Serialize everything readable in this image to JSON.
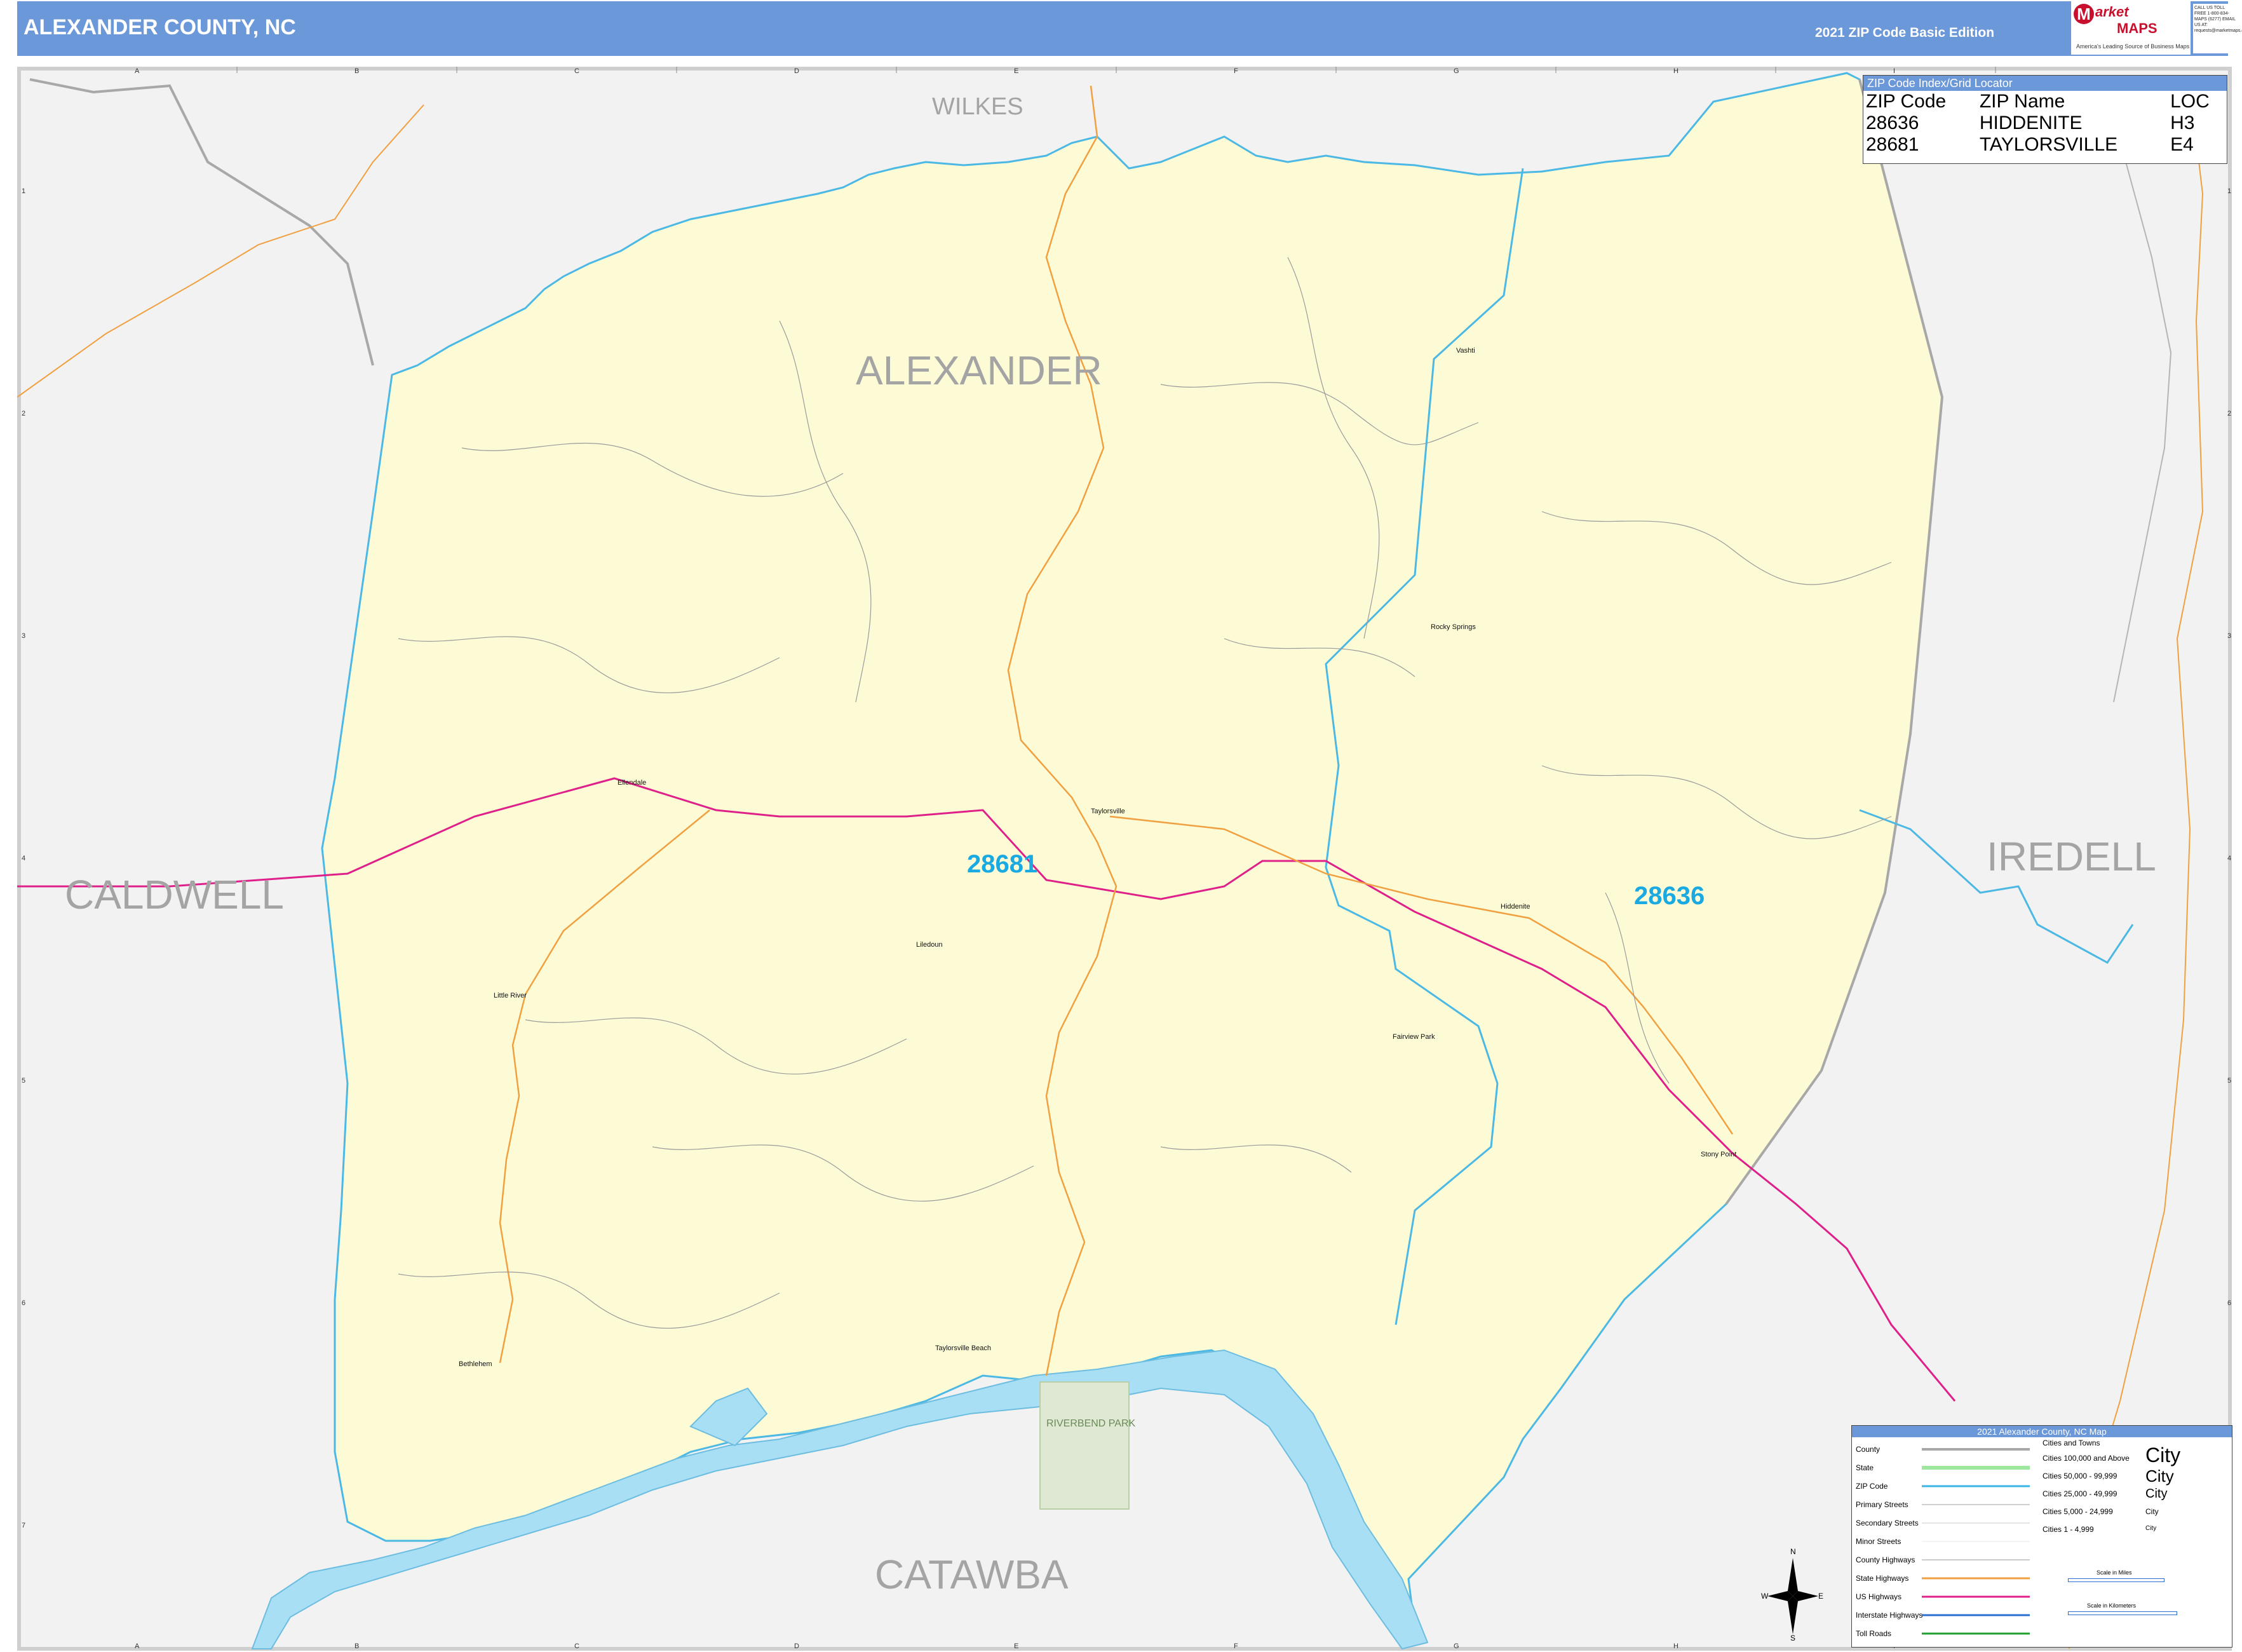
{
  "header": {
    "title": "ALEXANDER COUNTY, NC",
    "edition": "2021 ZIP Code Basic Edition",
    "logo_main": "arket",
    "logo_sub": "MAPS",
    "logo_tagline": "America's Leading Source of Business Maps",
    "contact": "CALL US TOLL FREE 1-800-834-MAPS (6277) EMAIL US AT: requests@marketmaps.com"
  },
  "grid": {
    "columns": [
      "A",
      "B",
      "C",
      "D",
      "E",
      "F",
      "G",
      "H",
      "I"
    ],
    "rows": [
      "1",
      "2",
      "3",
      "4",
      "5",
      "6",
      "7"
    ]
  },
  "counties": {
    "wilkes": "WILKES",
    "alexander": "ALEXANDER",
    "caldwell": "CALDWELL",
    "iredell": "IREDELL",
    "catawba": "CATAWBA"
  },
  "zip_labels": {
    "z28681": "28681",
    "z28636": "28636"
  },
  "places": {
    "taylorsville": "Taylorsville",
    "ellendale": "Ellendale",
    "vashti": "Vashti",
    "rocky_springs": "Rocky Springs",
    "hiddenite": "Hiddenite",
    "liledoun": "Liledoun",
    "little_river": "Little River",
    "fairview_park": "Fairview Park",
    "stony_point": "Stony Point",
    "bethlehem": "Bethlehem",
    "taylorsville_beach": "Taylorsville Beach",
    "riverbend_park": "RIVERBEND PARK"
  },
  "zip_index": {
    "title": "ZIP Code Index/Grid Locator",
    "headers": [
      "ZIP Code",
      "ZIP Name",
      "LOC"
    ],
    "rows": [
      [
        "28636",
        "HIDDENITE",
        "H3"
      ],
      [
        "28681",
        "TAYLORSVILLE",
        "E4"
      ]
    ]
  },
  "legend": {
    "title": "2021 Alexander County, NC Map",
    "features": [
      "County",
      "State",
      "ZIP Code",
      "Primary Streets",
      "Secondary Streets",
      "Minor Streets",
      "County Highways",
      "State Highways",
      "US Highways",
      "Interstate Highways",
      "Toll Roads"
    ],
    "cities_header": "Cities and Towns",
    "city_classes": [
      "Cities 100,000 and Above",
      "Cities 50,000 - 99,999",
      "Cities 25,000 - 49,999",
      "Cities 5,000 - 24,999",
      "Cities 1 - 4,999"
    ],
    "city_samples": [
      "City",
      "City",
      "City",
      "City",
      "City"
    ],
    "scale_miles": "Scale in Miles",
    "scale_km": "Scale in Kilometers",
    "compass": [
      "N",
      "S",
      "E",
      "W"
    ],
    "colors": {
      "county": "#a8a8a8",
      "state": "#9ee89e",
      "zip": "#38b6e6",
      "state_hwy": "#f0a040",
      "us_hwy": "#e0208a",
      "interstate": "#2a6fd0",
      "toll": "#20a030"
    }
  }
}
